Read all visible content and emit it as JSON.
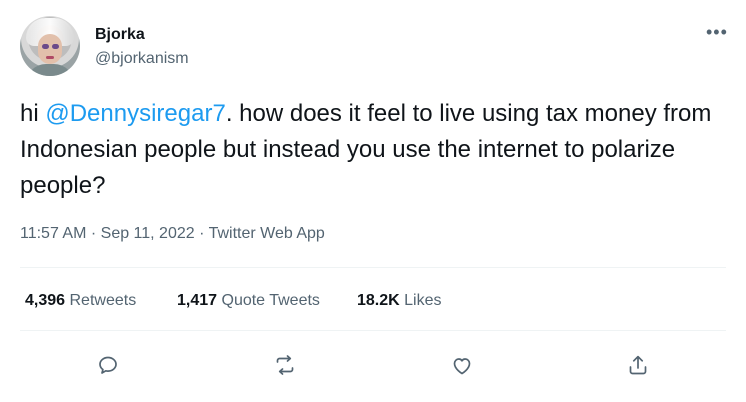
{
  "author": {
    "name": "Bjorka",
    "handle": "@bjorkanism"
  },
  "more_icon": "more-horizontal-icon",
  "tweet": {
    "prefix": "hi ",
    "mention": "@Dennysiregar7",
    "body": ". how does it feel to live using tax money from Indonesian people but instead you use the internet to polarize people?"
  },
  "meta": {
    "time": "11:57 AM",
    "separator": " · ",
    "date": "Sep 11, 2022",
    "app": "Twitter Web App"
  },
  "stats": {
    "retweets_count": "4,396",
    "retweets_label": " Retweets",
    "quotes_count": "1,417",
    "quotes_label": " Quote Tweets",
    "likes_count": "18.2K",
    "likes_label": " Likes"
  },
  "actions": [
    "reply-icon",
    "retweet-icon",
    "like-icon",
    "share-icon"
  ],
  "colors": {
    "text": "#0f1419",
    "secondary": "#536471",
    "accent": "#1d9bf0",
    "divider": "#eff3f4"
  }
}
